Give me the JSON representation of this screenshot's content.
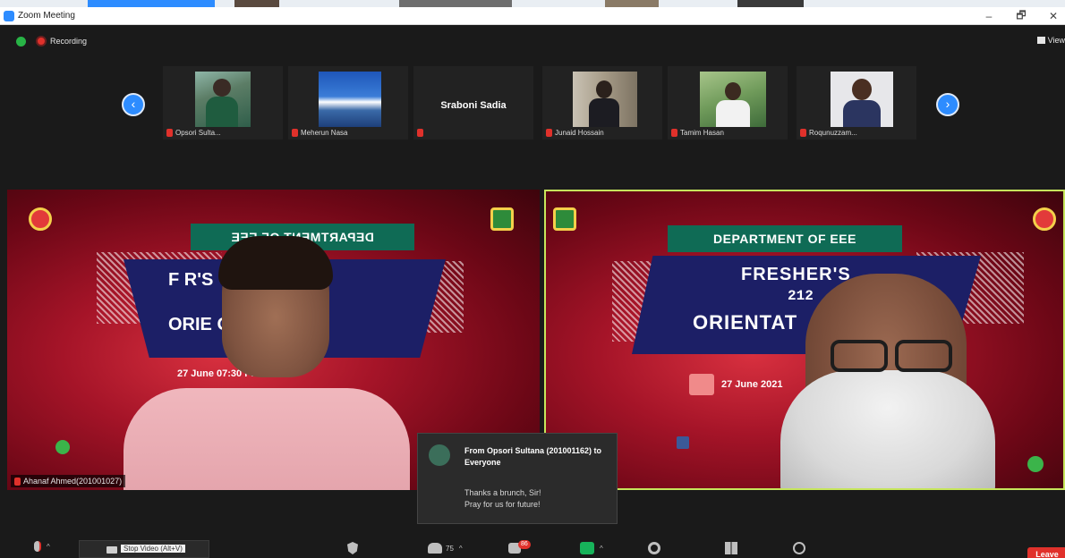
{
  "window": {
    "title": "Zoom Meeting",
    "controls": {
      "minimize": "–",
      "maximize": "🗗",
      "close": "✕"
    }
  },
  "infobar": {
    "recording_label": "Recording",
    "view_label": "View"
  },
  "participants_strip": [
    {
      "name": "Opsori Sulta...",
      "muted": true,
      "has_video": true
    },
    {
      "name": "Meherun Nasa",
      "muted": true,
      "has_video": true
    },
    {
      "name": "Sraboni Sadia",
      "muted": true,
      "has_video": false
    },
    {
      "name": "Junaid Hossain",
      "muted": true,
      "has_video": true
    },
    {
      "name": "Tamim Hasan",
      "muted": true,
      "has_video": true
    },
    {
      "name": "Roqunuzzam...",
      "muted": true,
      "has_video": true
    }
  ],
  "videos": {
    "left": {
      "participant": "Ahanaf Ahmed(201001027)",
      "slide_banner": "DEPARTMENT OF EEE",
      "slide_line1": "F       R'S",
      "slide_line2": "ORIE       ON",
      "slide_date": "27 June           07:30 PM"
    },
    "right": {
      "active_speaker": true,
      "slide_banner": "DEPARTMENT OF EEE",
      "slide_line1": "FRESHER'S",
      "slide_line2": "212",
      "slide_line3": "ORIENTAT",
      "slide_date": "27 June 2021"
    }
  },
  "chat_popup": {
    "from": "From Opsori Sultana (201001162) to Everyone",
    "message_line1": "Thanks a brunch, Sir!",
    "message_line2": "Pray for us for future!"
  },
  "toolbar": {
    "stop_video_label": "Stop Video (Alt+V)",
    "participants_count": "75",
    "chat_badge": "86",
    "leave_label": "Leave"
  },
  "colors": {
    "zoom_blue": "#2d8cff",
    "record_red": "#e0312b",
    "active_speaker_border": "#c6e65c",
    "banner_green": "#0f6b55",
    "slide_blue": "#1c1f66"
  },
  "icons": [
    "zoom-app-icon",
    "security-shield-icon",
    "record-icon",
    "view-grid-icon",
    "prev-arrow-icon",
    "next-arrow-icon",
    "mic-muted-icon",
    "video-camera-icon",
    "security-icon",
    "participants-icon",
    "chat-icon",
    "share-screen-icon",
    "record-button-icon",
    "apps-icon",
    "reactions-icon"
  ]
}
